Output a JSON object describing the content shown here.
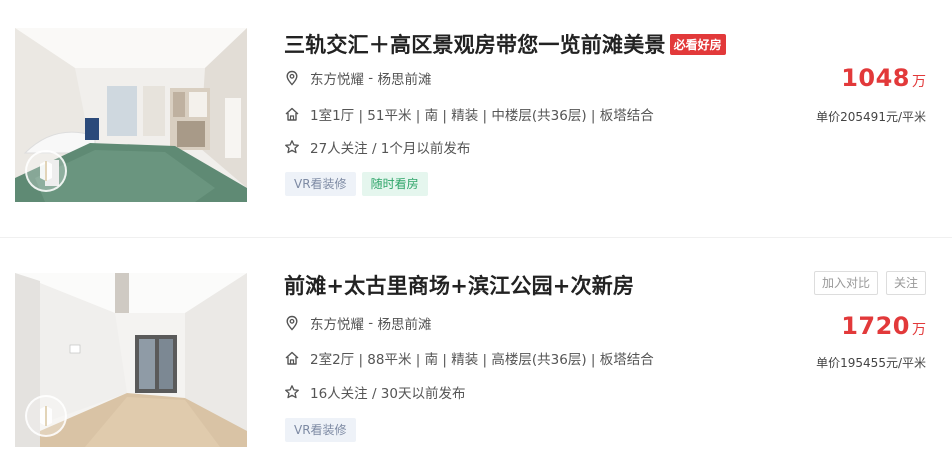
{
  "listings": [
    {
      "title": "三轨交汇＋高区景观房带您一览前滩美景",
      "badge": "必看好房",
      "location_community": "东方悦耀",
      "location_separator": " - ",
      "location_area": "杨思前滩",
      "house_info": "1室1厅 | 51平米 | 南 | 精装 | 中楼层(共36层) | 板塔结合",
      "follow_info": "27人关注 / 1个月以前发布",
      "tags": [
        "VR看装修",
        "随时看房"
      ],
      "total_price": "1048",
      "price_unit": "万",
      "unit_price": "单价205491元/平米"
    },
    {
      "title": "前滩+太古里商场+滨江公园+次新房",
      "location_community": "东方悦耀",
      "location_separator": " - ",
      "location_area": "杨思前滩",
      "house_info": "2室2厅 | 88平米 | 南 | 精装 | 高楼层(共36层) | 板塔结合",
      "follow_info": "16人关注 / 30天以前发布",
      "tags": [
        "VR看装修"
      ],
      "total_price": "1720",
      "price_unit": "万",
      "unit_price": "单价195455元/平米",
      "actions": {
        "compare_label": "加入对比",
        "follow_label": "关注"
      }
    }
  ],
  "colors": {
    "accent_red": "#e2393a",
    "vr_tag_text": "#7d8aa3",
    "visit_tag_text": "#2fa56a"
  },
  "icons": [
    "location-pin-icon",
    "house-icon",
    "star-icon",
    "vr-play-icon"
  ]
}
